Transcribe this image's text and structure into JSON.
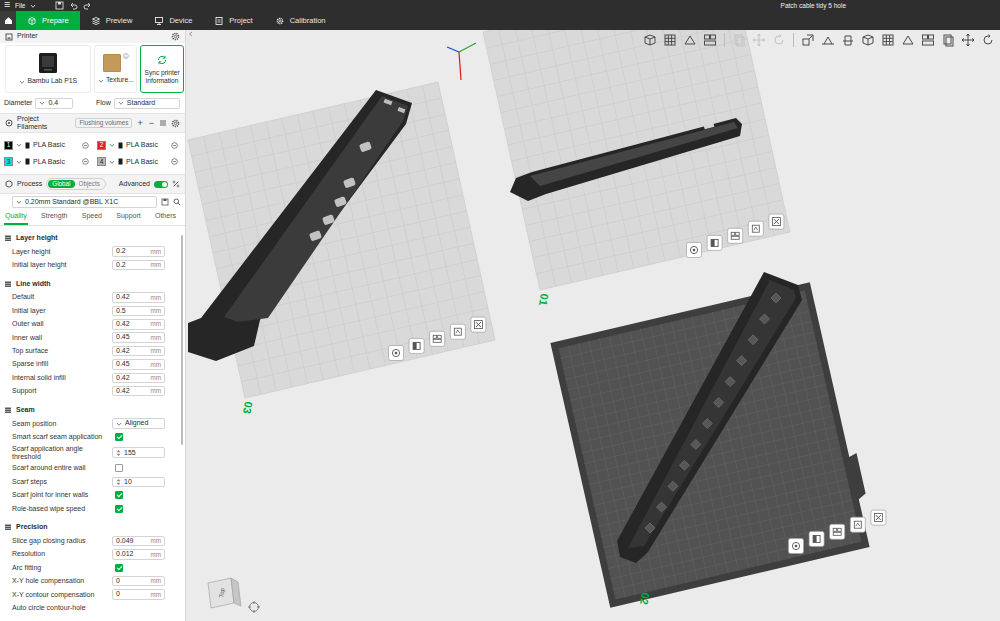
{
  "window": {
    "menu_icon": "☰",
    "menu": "File",
    "title": "Patch cable tidy 5 hole"
  },
  "tabs": [
    {
      "label": "Prepare",
      "selected": true
    },
    {
      "label": "Preview",
      "selected": false
    },
    {
      "label": "Device",
      "selected": false
    },
    {
      "label": "Project",
      "selected": false
    },
    {
      "label": "Calibration",
      "selected": false
    }
  ],
  "printer": {
    "title": "Printer",
    "model": "Bambu Lab P1S",
    "plate": "Texture...",
    "sync": "Sync printer information",
    "diameter_label": "Diameter",
    "diameter": "0.4",
    "flow_label": "Flow",
    "flow": "Standard"
  },
  "filaments": {
    "title": "Project Filaments",
    "flushing": "Flushing volumes",
    "add": "+",
    "remove": "−",
    "items": [
      {
        "index": "1",
        "name": "PLA Basic",
        "color": "#000000"
      },
      {
        "index": "2",
        "name": "PLA Basic",
        "color": "#e8201a"
      },
      {
        "index": "3",
        "name": "PLA Basic",
        "color": "#19d9e0"
      },
      {
        "index": "4",
        "name": "PLA Basic",
        "color": "#b8b8b8"
      }
    ]
  },
  "process": {
    "title": "Process",
    "scope": [
      {
        "label": "Global",
        "selected": true
      },
      {
        "label": "Objects",
        "selected": false
      }
    ],
    "advanced_label": "Advanced",
    "advanced": true,
    "preset": "0.20mm Standard @BBL X1C"
  },
  "settings_tabs": [
    {
      "label": "Quality",
      "selected": true
    },
    {
      "label": "Strength",
      "selected": false
    },
    {
      "label": "Speed",
      "selected": false
    },
    {
      "label": "Support",
      "selected": false
    },
    {
      "label": "Others",
      "selected": false
    }
  ],
  "sections": [
    {
      "title": "Layer height",
      "rows": [
        {
          "kind": "number",
          "label": "Layer height",
          "value": "0.2",
          "unit": "mm"
        },
        {
          "kind": "number",
          "label": "Initial layer height",
          "value": "0.2",
          "unit": "mm"
        }
      ]
    },
    {
      "title": "Line width",
      "rows": [
        {
          "kind": "number",
          "label": "Default",
          "value": "0.42",
          "unit": "mm"
        },
        {
          "kind": "number",
          "label": "Initial layer",
          "value": "0.5",
          "unit": "mm"
        },
        {
          "kind": "number",
          "label": "Outer wall",
          "value": "0.42",
          "unit": "mm"
        },
        {
          "kind": "number",
          "label": "Inner wall",
          "value": "0.45",
          "unit": "mm"
        },
        {
          "kind": "number",
          "label": "Top surface",
          "value": "0.42",
          "unit": "mm"
        },
        {
          "kind": "number",
          "label": "Sparse infill",
          "value": "0.45",
          "unit": "mm"
        },
        {
          "kind": "number",
          "label": "Internal solid infill",
          "value": "0.42",
          "unit": "mm"
        },
        {
          "kind": "number",
          "label": "Support",
          "value": "0.42",
          "unit": "mm"
        }
      ]
    },
    {
      "title": "Seam",
      "rows": [
        {
          "kind": "select",
          "label": "Seam position",
          "value": "Aligned"
        },
        {
          "kind": "check",
          "label": "Smart scarf seam application",
          "checked": true
        },
        {
          "kind": "spin",
          "label": "Scarf application angle threshold",
          "value": "155"
        },
        {
          "kind": "check",
          "label": "Scarf around entire wall",
          "checked": false
        },
        {
          "kind": "spin",
          "label": "Scarf steps",
          "value": "10"
        },
        {
          "kind": "check",
          "label": "Scarf joint for inner walls",
          "checked": true
        },
        {
          "kind": "check",
          "label": "Role-based wipe speed",
          "checked": true
        }
      ]
    },
    {
      "title": "Precision",
      "rows": [
        {
          "kind": "number",
          "label": "Slice gap closing radius",
          "value": "0.049",
          "unit": "mm"
        },
        {
          "kind": "number",
          "label": "Resolution",
          "value": "0.012",
          "unit": "mm"
        },
        {
          "kind": "check",
          "label": "Arc fitting",
          "checked": true
        },
        {
          "kind": "number",
          "label": "X-Y hole compensation",
          "value": "0",
          "unit": "mm"
        },
        {
          "kind": "number",
          "label": "X-Y contour compensation",
          "value": "0",
          "unit": "mm"
        },
        {
          "kind": "label",
          "label": "Auto circle contour-hole"
        }
      ]
    }
  ],
  "toolbar": [
    {
      "kind": "button",
      "disabled": false
    },
    {
      "kind": "button",
      "disabled": false
    },
    {
      "kind": "button",
      "disabled": false
    },
    {
      "kind": "button",
      "disabled": false
    },
    {
      "kind": "separator"
    },
    {
      "kind": "button",
      "disabled": true
    },
    {
      "kind": "button",
      "disabled": true
    },
    {
      "kind": "button",
      "disabled": true
    },
    {
      "kind": "separator"
    },
    {
      "kind": "button",
      "disabled": false
    },
    {
      "kind": "button",
      "disabled": false
    },
    {
      "kind": "button",
      "disabled": false
    },
    {
      "kind": "button",
      "disabled": false
    },
    {
      "kind": "button",
      "disabled": false
    },
    {
      "kind": "button",
      "disabled": false
    },
    {
      "kind": "button",
      "disabled": false
    },
    {
      "kind": "button",
      "disabled": false
    },
    {
      "kind": "button",
      "disabled": false
    },
    {
      "kind": "button",
      "disabled": false
    }
  ],
  "plates": [
    {
      "number": "03",
      "selected": false
    },
    {
      "number": "01",
      "selected": false
    },
    {
      "number": "02",
      "selected": true
    }
  ],
  "view_cube": {
    "label": "Top"
  }
}
